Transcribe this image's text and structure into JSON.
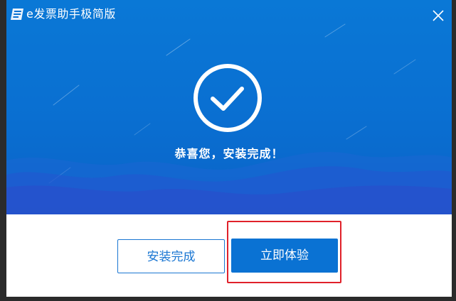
{
  "window": {
    "title": "e发票助手极简版",
    "icons": {
      "app": "invoice-app-icon",
      "close": "close-icon",
      "status": "checkmark-circle-icon"
    }
  },
  "hero": {
    "message": "恭喜您，安装完成！"
  },
  "actions": {
    "done_label": "安装完成",
    "try_label": "立即体验"
  },
  "colors": {
    "hero_blue": "#0a72d3",
    "button_primary": "#0a72d3",
    "button_outline": "#1a76d2",
    "highlight_red": "#e0212a"
  }
}
